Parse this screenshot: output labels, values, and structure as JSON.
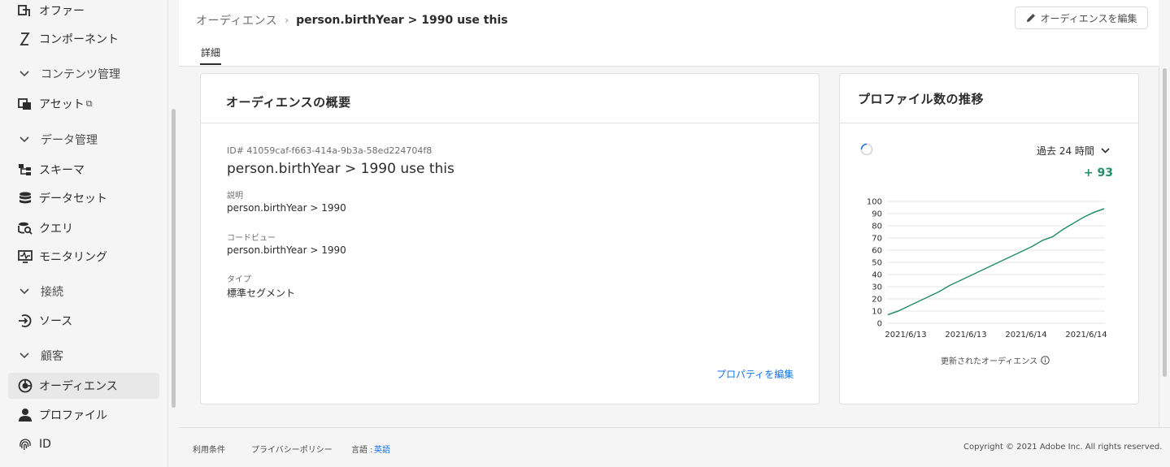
{
  "sidebar": {
    "items": [
      {
        "label": "オファー",
        "icon": "offer-icon"
      },
      {
        "label": "コンポーネント",
        "icon": "component-icon"
      },
      {
        "label": "コンテンツ管理",
        "group": true
      },
      {
        "label": "アセット",
        "icon": "asset-icon",
        "external": "⧉"
      },
      {
        "label": "データ管理",
        "group": true
      },
      {
        "label": "スキーマ",
        "icon": "schema-icon"
      },
      {
        "label": "データセット",
        "icon": "dataset-icon"
      },
      {
        "label": "クエリ",
        "icon": "query-icon"
      },
      {
        "label": "モニタリング",
        "icon": "monitoring-icon"
      },
      {
        "label": "接続",
        "group": true
      },
      {
        "label": "ソース",
        "icon": "source-icon"
      },
      {
        "label": "顧客",
        "group": true
      },
      {
        "label": "オーディエンス",
        "icon": "audience-icon",
        "active": true
      },
      {
        "label": "プロファイル",
        "icon": "profile-icon"
      },
      {
        "label": "ID",
        "icon": "fingerprint-icon"
      }
    ]
  },
  "header": {
    "breadcrumb_root": "オーディエンス",
    "breadcrumb_sep": "›",
    "breadcrumb_current": "person.birthYear > 1990 use this",
    "edit_button": "オーディエンスを編集",
    "tab": "詳細"
  },
  "overview": {
    "title": "オーディエンスの概要",
    "id": "ID# 41059caf-f663-414a-9b3a-58ed224704f8",
    "name": "person.birthYear > 1990 use this",
    "description_label": "説明",
    "description": "person.birthYear > 1990",
    "code_label": "コードビュー",
    "code": "person.birthYear > 1990",
    "type_label": "タイプ",
    "type": "標準セグメント",
    "edit_props": "プロパティを編集"
  },
  "trend": {
    "title": "プロファイル数の推移",
    "range": "過去 24 時間",
    "delta": "+ 93",
    "footer_label": "更新されたオーディエンス",
    "accent": "#268e6c"
  },
  "chart_data": {
    "type": "line",
    "x": [
      "2021/6/13",
      "2021/6/13",
      "2021/6/14",
      "2021/6/14"
    ],
    "series": [
      {
        "values": [
          7,
          10,
          14,
          18,
          22,
          26,
          31,
          35,
          39,
          43,
          47,
          51,
          55,
          59,
          63,
          68,
          71,
          77,
          82,
          87,
          91,
          94
        ]
      }
    ],
    "ylim": [
      0,
      100
    ],
    "yticks": [
      0,
      10,
      20,
      30,
      40,
      50,
      60,
      70,
      80,
      90,
      100
    ],
    "grid": true
  },
  "footer": {
    "terms": "利用条件",
    "privacy": "プライバシーポリシー",
    "language_label": "言語 :",
    "language": "英語",
    "copyright": "Copyright ©  2021 Adobe Inc.  All rights reserved."
  }
}
